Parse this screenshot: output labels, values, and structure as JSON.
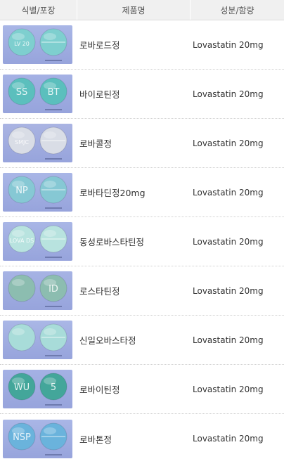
{
  "headers": {
    "image": "식별/포장",
    "name": "제품명",
    "ingredient": "성분/함량"
  },
  "rows": [
    {
      "name": "로바로드정",
      "ingredient": "Lovastatin 20mg",
      "marks": [
        "LV 20",
        ""
      ],
      "pill_color": "#7ecfcf",
      "bg": "#a9b6e6"
    },
    {
      "name": "바이로틴정",
      "ingredient": "Lovastatin 20mg",
      "marks": [
        "SS",
        "BT"
      ],
      "pill_color": "#5bbfbd",
      "bg": "#a4b1e4"
    },
    {
      "name": "로바콜정",
      "ingredient": "Lovastatin 20mg",
      "marks": [
        "SMJC",
        ""
      ],
      "pill_color": "#d9dde6",
      "bg": "#aab4e2"
    },
    {
      "name": "로바타딘정20mg",
      "ingredient": "Lovastatin 20mg",
      "marks": [
        "NP",
        ""
      ],
      "pill_color": "#86c8d4",
      "bg": "#a9b6e6"
    },
    {
      "name": "동성로바스타틴정",
      "ingredient": "Lovastatin 20mg",
      "marks": [
        "LOVA DS",
        ""
      ],
      "pill_color": "#b8e3df",
      "bg": "#a9b6e6"
    },
    {
      "name": "로스타틴정",
      "ingredient": "Lovastatin 20mg",
      "marks": [
        "",
        "ID"
      ],
      "pill_color": "#8cbdb0",
      "bg": "#a6b3e4"
    },
    {
      "name": "신일오바스타정",
      "ingredient": "Lovastatin 20mg",
      "marks": [
        "",
        ""
      ],
      "pill_color": "#a8dcd9",
      "bg": "#aab7e6"
    },
    {
      "name": "로바이틴정",
      "ingredient": "Lovastatin 20mg",
      "marks": [
        "WU",
        "5"
      ],
      "pill_color": "#43a69a",
      "bg": "#a4b1e4"
    },
    {
      "name": "로바톤정",
      "ingredient": "Lovastatin 20mg",
      "marks": [
        "NSP",
        ""
      ],
      "pill_color": "#6ab3dc",
      "bg": "#a9b6e6"
    }
  ]
}
